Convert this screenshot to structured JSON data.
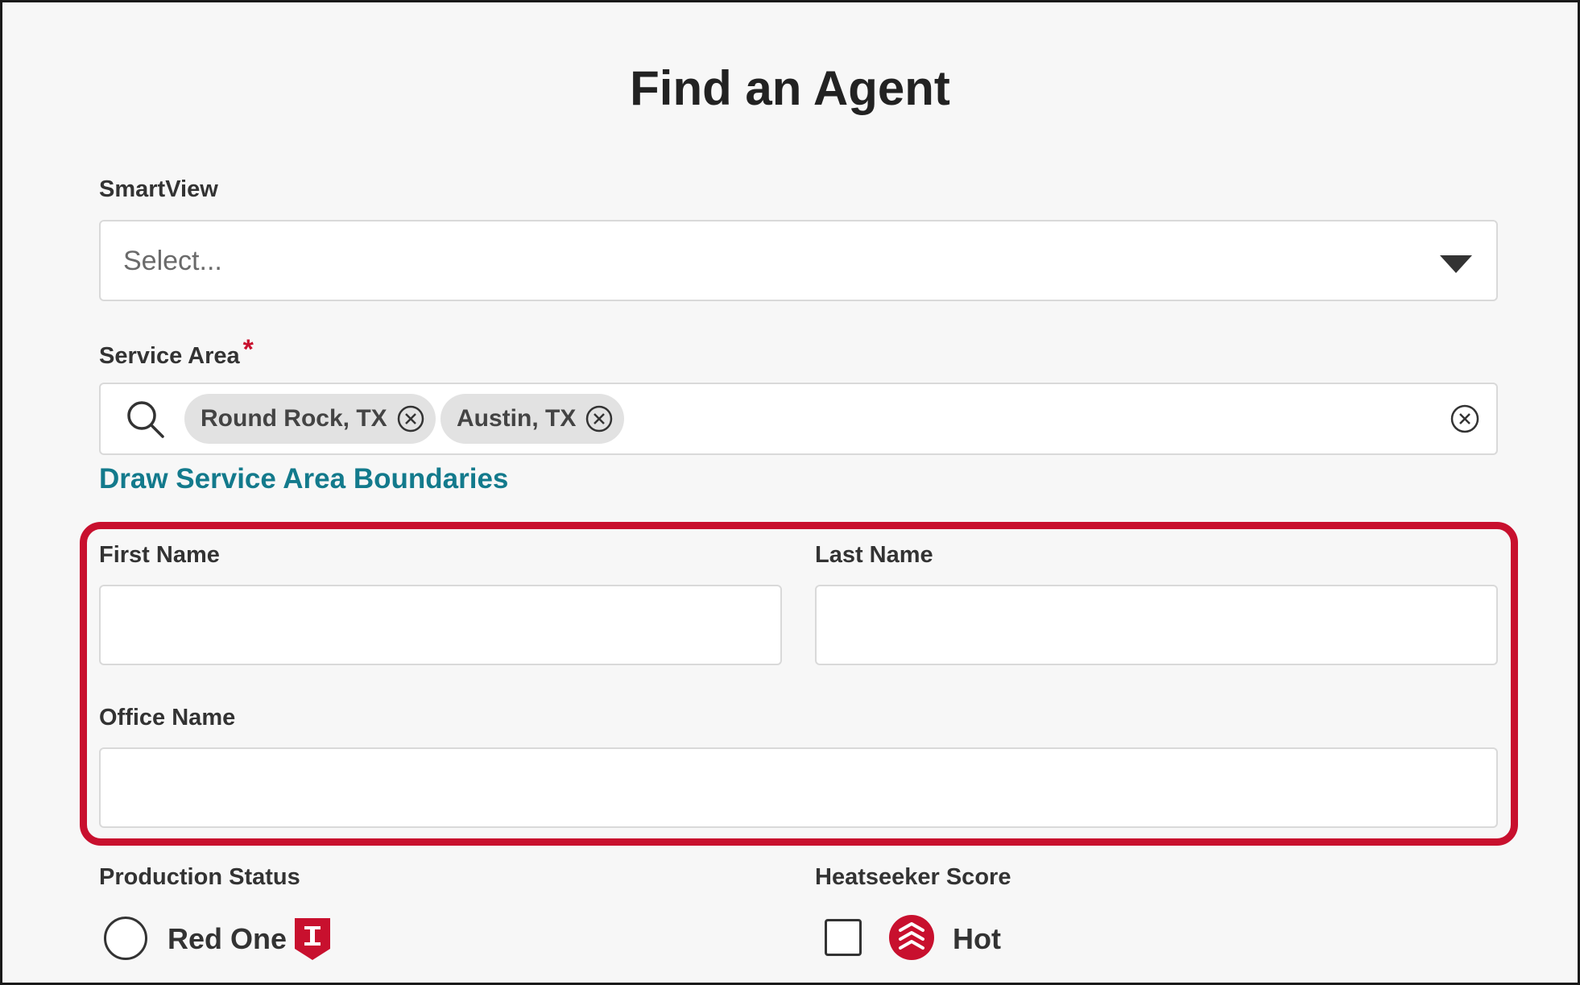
{
  "page": {
    "title": "Find an Agent"
  },
  "smartview": {
    "label": "SmartView",
    "placeholder": "Select..."
  },
  "service_area": {
    "label": "Service Area",
    "required_marker": "*",
    "chips": [
      {
        "label": "Round Rock, TX"
      },
      {
        "label": "Austin, TX"
      }
    ],
    "draw_link": "Draw Service Area Boundaries"
  },
  "first_name": {
    "label": "First Name",
    "value": ""
  },
  "last_name": {
    "label": "Last Name",
    "value": ""
  },
  "office_name": {
    "label": "Office Name",
    "value": ""
  },
  "production_status": {
    "label": "Production Status",
    "options": [
      {
        "label": "Red One",
        "selected": false,
        "icon": "red-one-badge-icon"
      }
    ]
  },
  "heatseeker_score": {
    "label": "Heatseeker Score",
    "options": [
      {
        "label": "Hot",
        "checked": false,
        "icon": "hot-score-icon"
      }
    ]
  },
  "colors": {
    "accent_link": "#137a8c",
    "highlight_border": "#c8102e",
    "required": "#c8102e",
    "brand_red": "#c8102e"
  }
}
